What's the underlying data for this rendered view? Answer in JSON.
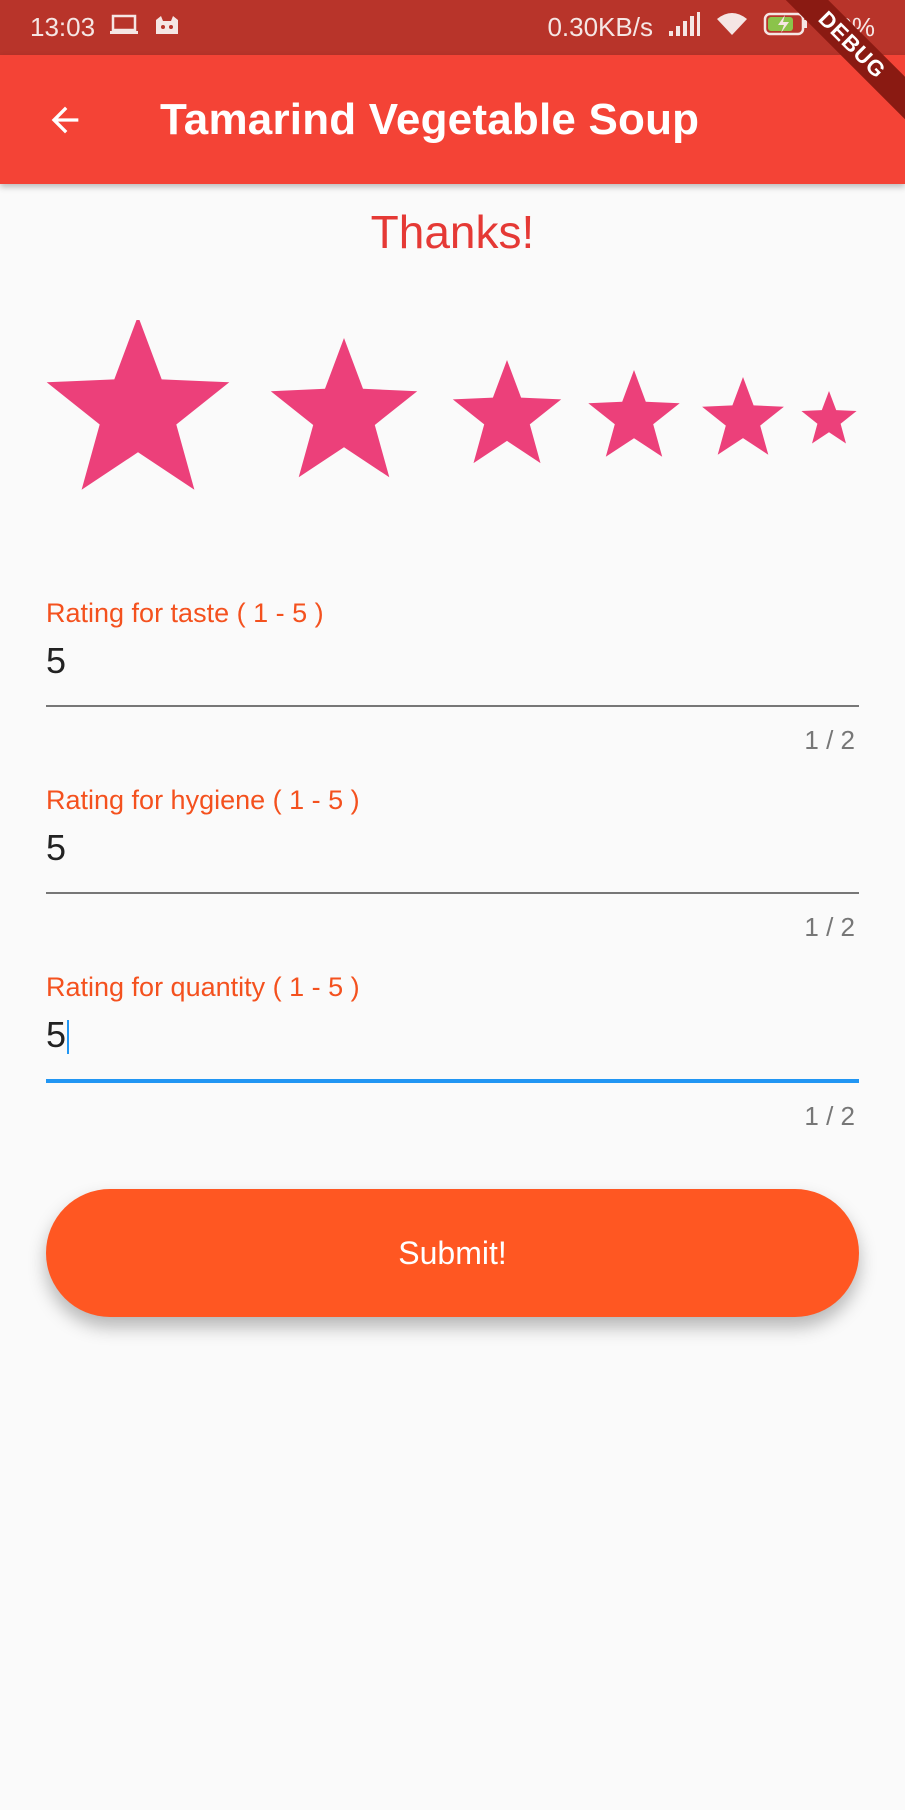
{
  "status_bar": {
    "time": "13:03",
    "net_speed": "0.30KB/s",
    "battery": "68%",
    "icons": [
      "laptop-icon",
      "cat-icon",
      "signal-icon",
      "wifi-icon",
      "battery-charging-icon"
    ]
  },
  "app_bar": {
    "title": "Tamarind Vegetable Soup",
    "back_icon": "arrow-back-icon",
    "debug_label": "DEBUG"
  },
  "main": {
    "thanks": "Thanks!",
    "rating_stars": {
      "count": 6,
      "color": "#ec407a",
      "icon": "star-icon"
    },
    "fields": [
      {
        "label": "Rating for taste ( 1 - 5 )",
        "value": "5",
        "counter": "1 / 2"
      },
      {
        "label": "Rating for hygiene ( 1 - 5 )",
        "value": "5",
        "counter": "1 / 2"
      },
      {
        "label": "Rating for quantity ( 1 - 5 )",
        "value": "5",
        "counter": "1 / 2"
      }
    ],
    "submit_label": "Submit!"
  },
  "colors": {
    "app_bar": "#f44336",
    "status_bar": "#b8342a",
    "accent": "#ff5722",
    "focus": "#2196f3",
    "star": "#ec407a"
  }
}
